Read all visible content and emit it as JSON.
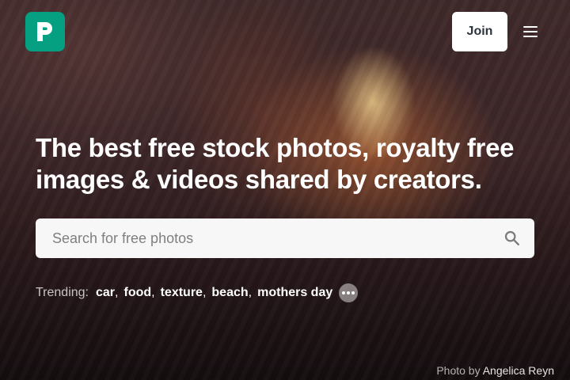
{
  "header": {
    "logo_icon": "pexels-logo-icon",
    "join_label": "Join",
    "menu_icon": "hamburger-menu-icon"
  },
  "hero": {
    "headline_line1": "The best free stock photos, royalty free",
    "headline_line2": "images & videos shared by creators."
  },
  "search": {
    "placeholder": "Search for free photos",
    "value": "",
    "icon": "search-icon"
  },
  "trending": {
    "label": "Trending:",
    "items": [
      "car",
      "food",
      "texture",
      "beach",
      "mothers day"
    ],
    "more_icon": "more-dots-icon"
  },
  "credit": {
    "prefix": "Photo by",
    "author": "Angelica Reyn"
  },
  "colors": {
    "brand": "#05a081",
    "text_dark": "#2c343e"
  }
}
